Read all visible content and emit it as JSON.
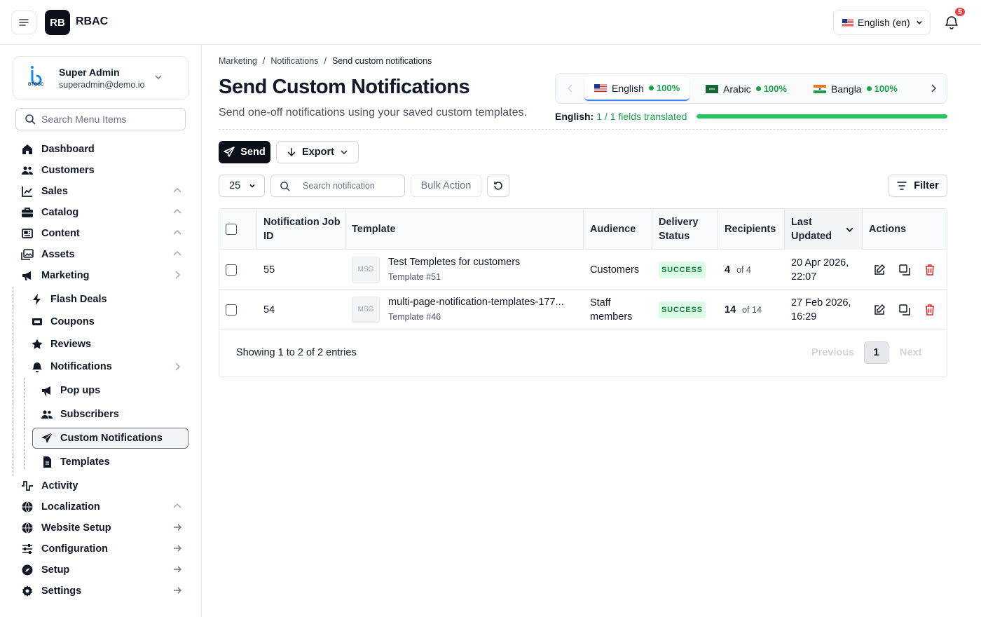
{
  "app": {
    "logo_text": "RB",
    "brand": "RBAC"
  },
  "topbar": {
    "language": "English (en)",
    "notification_count": "5"
  },
  "user": {
    "logo_text": "BTOSC",
    "name": "Super Admin",
    "email": "superadmin@demo.io"
  },
  "sidebar": {
    "search_placeholder": "Search Menu Items",
    "items": [
      {
        "label": "Dashboard"
      },
      {
        "label": "Customers"
      },
      {
        "label": "Sales"
      },
      {
        "label": "Catalog"
      },
      {
        "label": "Content"
      },
      {
        "label": "Assets"
      },
      {
        "label": "Marketing"
      },
      {
        "label": "Flash Deals"
      },
      {
        "label": "Coupons"
      },
      {
        "label": "Reviews"
      },
      {
        "label": "Notifications"
      },
      {
        "label": "Pop ups"
      },
      {
        "label": "Subscribers"
      },
      {
        "label": "Custom Notifications"
      },
      {
        "label": "Templates"
      },
      {
        "label": "Activity"
      },
      {
        "label": "Localization"
      },
      {
        "label": "Website Setup"
      },
      {
        "label": "Configuration"
      },
      {
        "label": "Setup"
      },
      {
        "label": "Settings"
      }
    ]
  },
  "breadcrumb": {
    "b1": "Marketing",
    "b2": "Notifications",
    "b3": "Send custom notifications",
    "sep": "/"
  },
  "page": {
    "title": "Send Custom Notifications",
    "subtitle": "Send one-off notifications using your saved custom templates."
  },
  "translations": {
    "tabs": [
      {
        "label": "English",
        "pct": "100%"
      },
      {
        "label": "Arabic",
        "pct": "100%"
      },
      {
        "label": "Bangla",
        "pct": "100%"
      }
    ],
    "status_label": "English:",
    "status_value": "1 / 1 fields translated",
    "progress": 1.0
  },
  "toolbar": {
    "send": "Send",
    "export": "Export",
    "per_page": "25",
    "search_placeholder": "Search notification",
    "bulk_action": "Bulk Action",
    "filter": "Filter"
  },
  "table": {
    "headers": {
      "job_id": "Notification Job ID",
      "template": "Template",
      "audience": "Audience",
      "status": "Delivery Status",
      "recipients": "Recipients",
      "updated": "Last Updated",
      "actions": "Actions"
    },
    "rows": [
      {
        "id": "55",
        "thumb": "MSG",
        "template_name": "Test Templetes for customers",
        "template_sub": "Template #51",
        "audience": "Customers",
        "status": "SUCCESS",
        "recipients": "4",
        "recipients_of": "of 4",
        "updated": "20 Apr 2026, 22:07"
      },
      {
        "id": "54",
        "thumb": "MSG",
        "template_name": "multi-page-notification-templates-177...",
        "template_sub": "Template #46",
        "audience": "Staff members",
        "status": "SUCCESS",
        "recipients": "14",
        "recipients_of": "of 14",
        "updated": "27 Feb 2026, 16:29"
      }
    ],
    "footer": "Showing 1 to 2 of 2 entries",
    "pagination": {
      "previous": "Previous",
      "page": "1",
      "next": "Next"
    }
  },
  "colors": {
    "primary": "#0b0f1a",
    "success": "#16a34a",
    "danger": "#dc2626",
    "accent": "#3b82f6"
  }
}
